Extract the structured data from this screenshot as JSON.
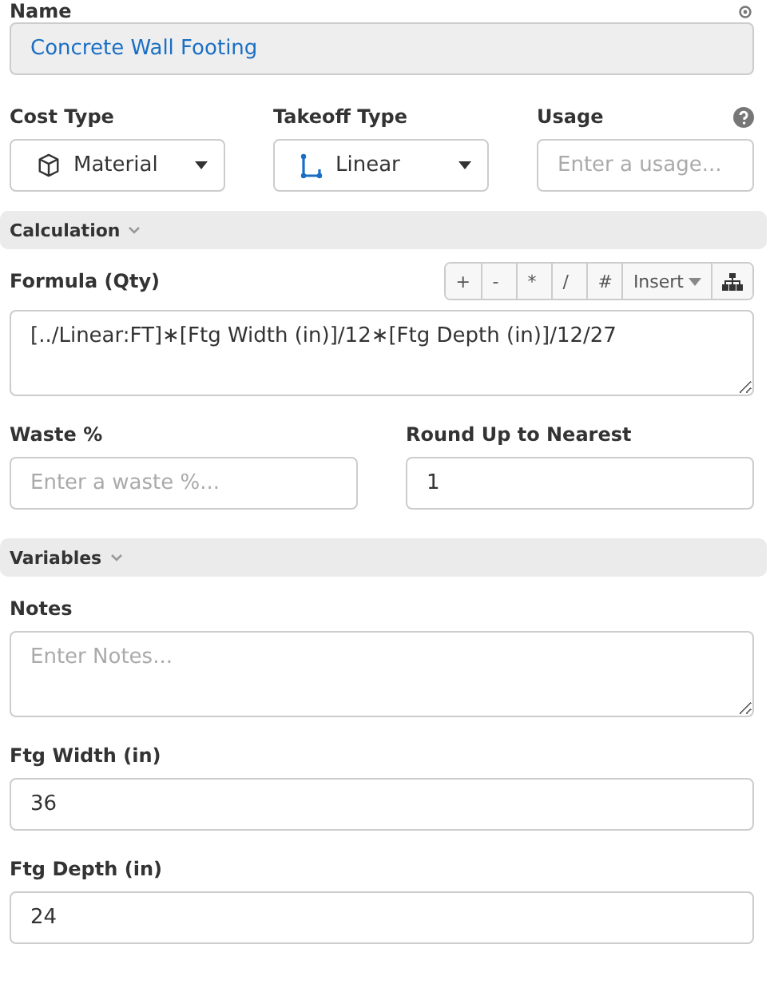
{
  "name": {
    "label": "Name",
    "value": "Concrete Wall Footing"
  },
  "cost_type": {
    "label": "Cost Type",
    "value": "Material"
  },
  "takeoff_type": {
    "label": "Takeoff Type",
    "value": "Linear"
  },
  "usage": {
    "label": "Usage",
    "placeholder": "Enter a usage..."
  },
  "calculation": {
    "title": "Calculation",
    "expanded": true
  },
  "formula": {
    "label": "Formula (Qty)",
    "operators": [
      "+",
      "-",
      "*",
      "/",
      "#"
    ],
    "insert": "Insert",
    "value": "[../Linear:FT]∗[Ftg Width (in)]/12∗[Ftg Depth (in)]/12/27"
  },
  "waste": {
    "label": "Waste %",
    "placeholder": "Enter a waste %..."
  },
  "round_up": {
    "label": "Round Up to Nearest",
    "value": "1"
  },
  "variables": {
    "title": "Variables",
    "expanded": true
  },
  "notes": {
    "label": "Notes",
    "placeholder": "Enter Notes..."
  },
  "fields": [
    {
      "label": "Ftg Width (in)",
      "value": "36"
    },
    {
      "label": "Ftg Depth (in)",
      "value": "24"
    }
  ]
}
